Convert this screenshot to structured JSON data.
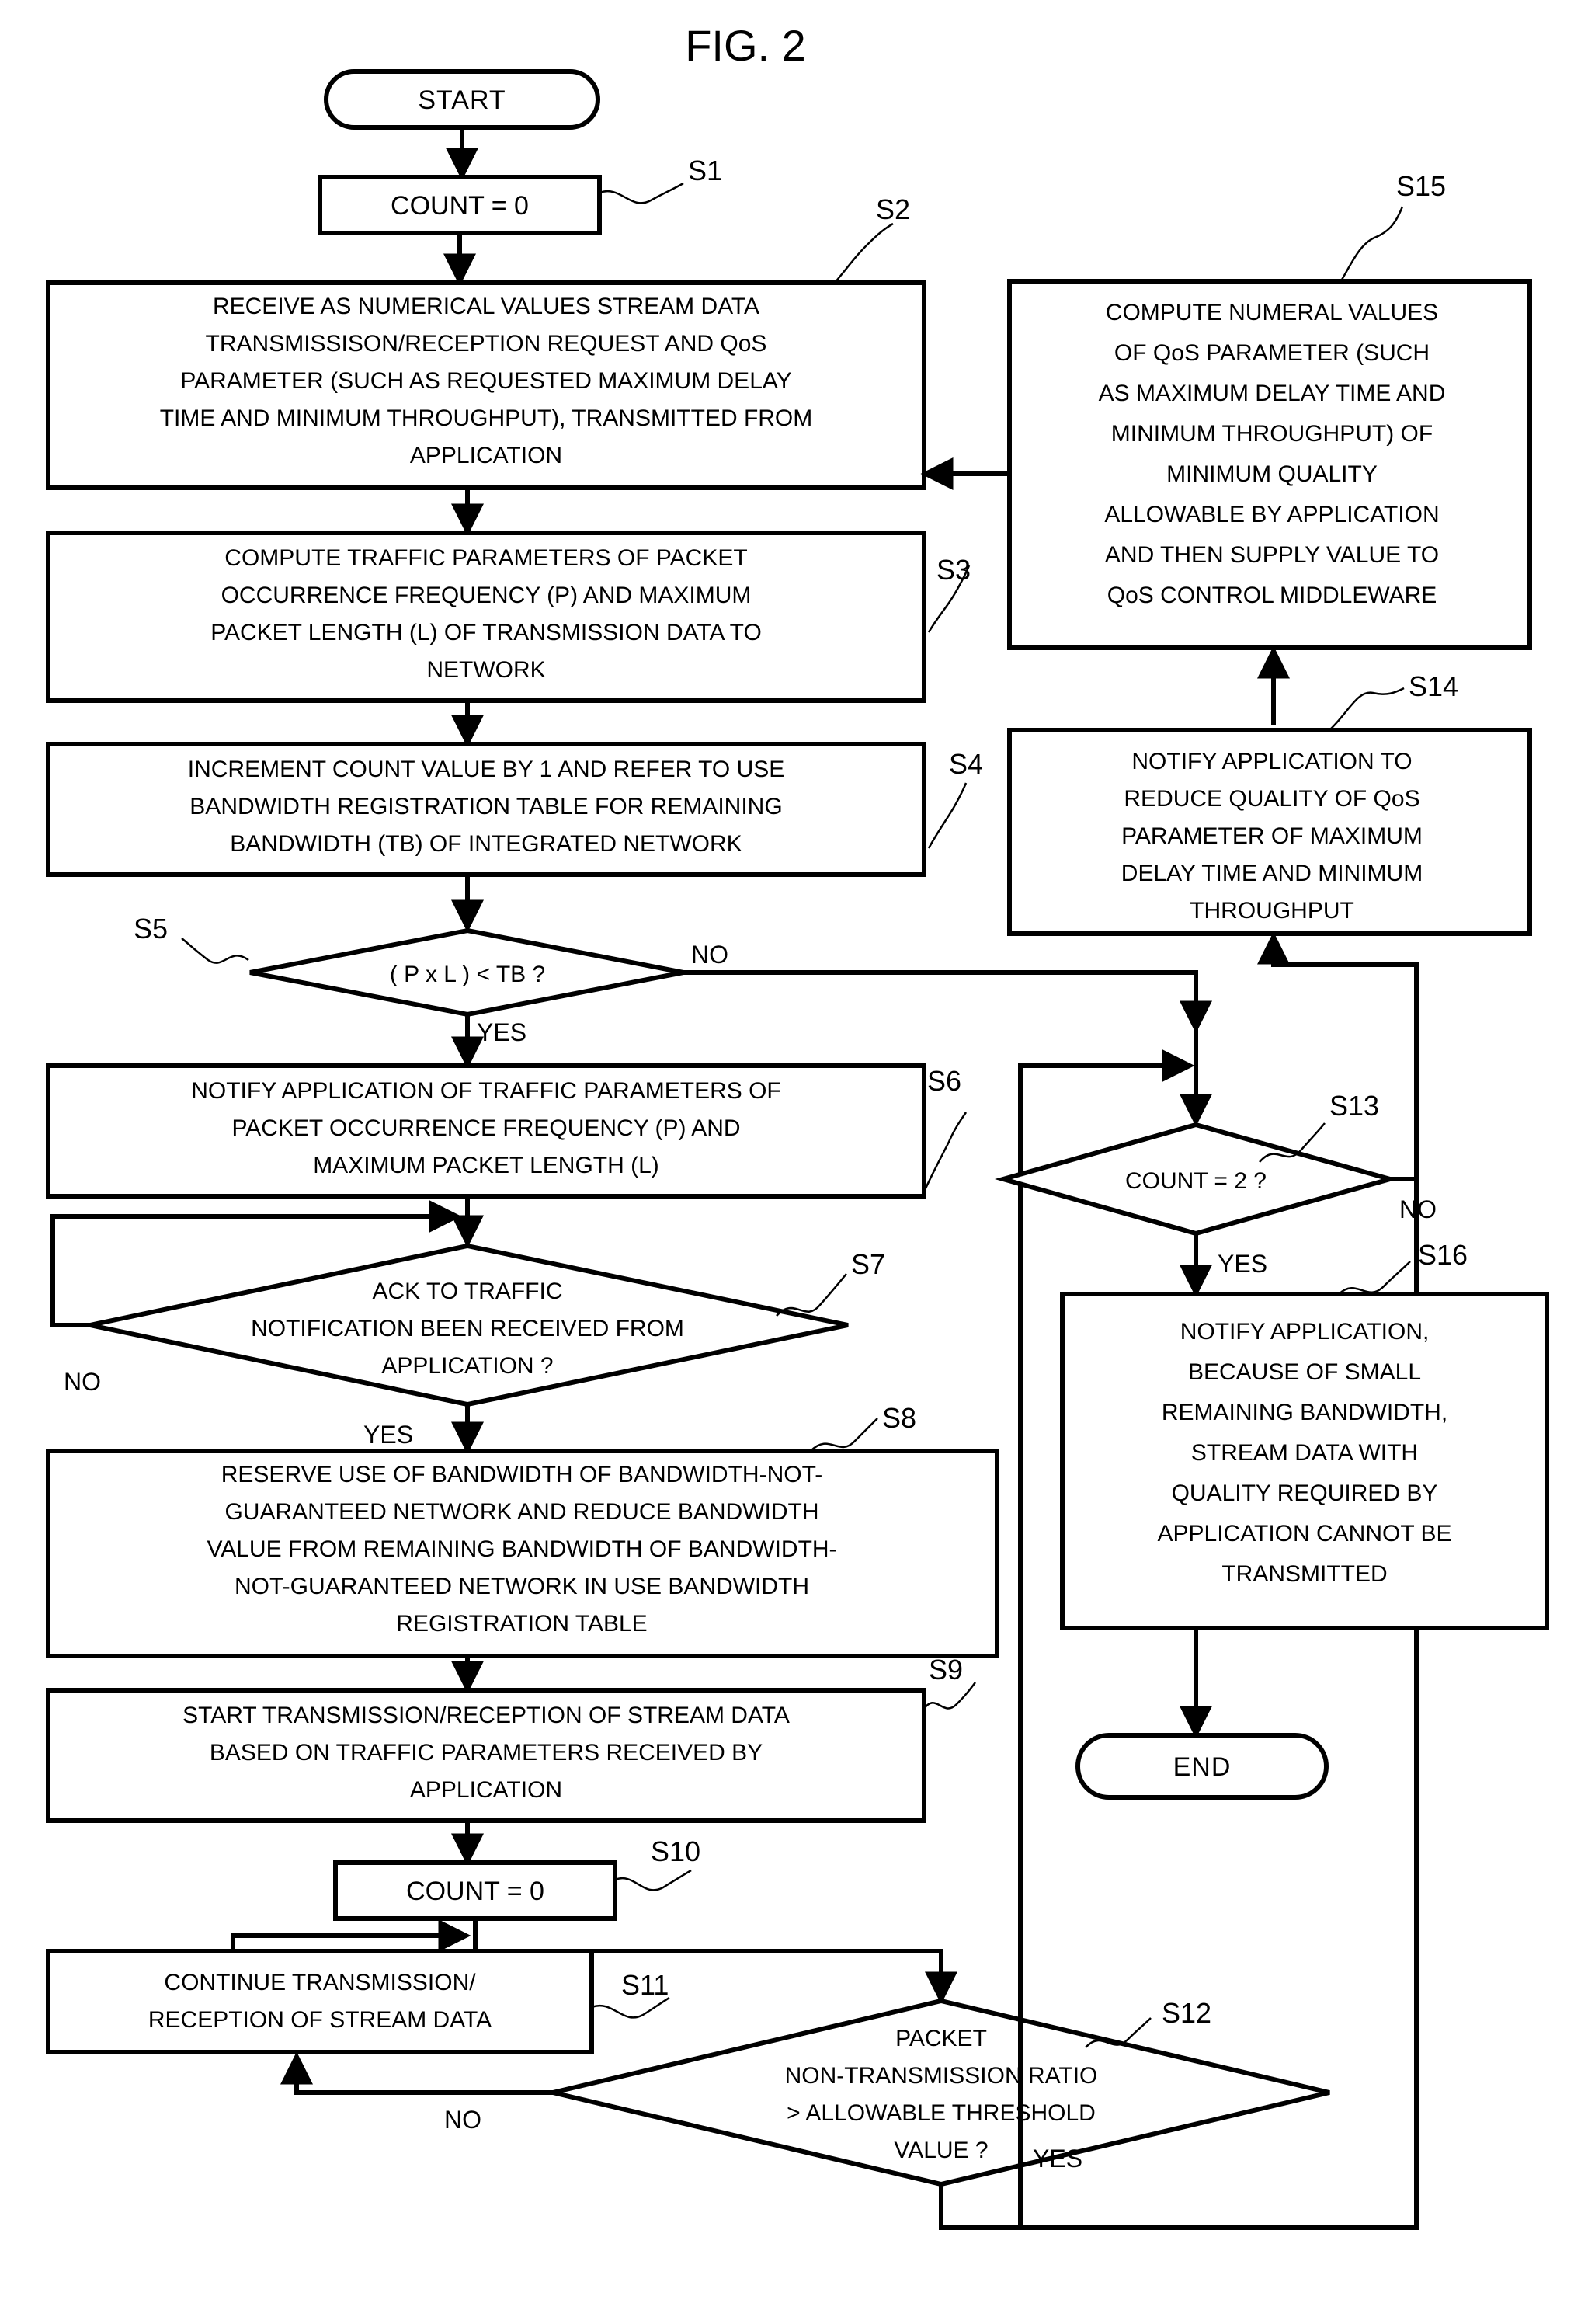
{
  "figure": {
    "title": "FIG. 2"
  },
  "terminals": {
    "start": "START",
    "end": "END"
  },
  "step_labels": {
    "s1": "S1",
    "s2": "S2",
    "s3": "S3",
    "s4": "S4",
    "s5": "S5",
    "s6": "S6",
    "s7": "S7",
    "s8": "S8",
    "s9": "S9",
    "s10": "S10",
    "s11": "S11",
    "s12": "S12",
    "s13": "S13",
    "s14": "S14",
    "s15": "S15",
    "s16": "S16"
  },
  "nodes": {
    "s1": {
      "id": "S1",
      "type": "process",
      "lines": [
        "COUNT = 0"
      ]
    },
    "s2": {
      "id": "S2",
      "type": "process",
      "lines": [
        "RECEIVE AS NUMERICAL VALUES STREAM DATA",
        "TRANSMISSISON/RECEPTION REQUEST AND QoS",
        "PARAMETER (SUCH AS REQUESTED MAXIMUM DELAY",
        "TIME AND MINIMUM THROUGHPUT), TRANSMITTED FROM",
        "APPLICATION"
      ]
    },
    "s3": {
      "id": "S3",
      "type": "process",
      "lines": [
        "COMPUTE TRAFFIC PARAMETERS OF PACKET",
        "OCCURRENCE FREQUENCY (P) AND MAXIMUM",
        "PACKET LENGTH (L)  OF TRANSMISSION DATA TO",
        "NETWORK"
      ]
    },
    "s4": {
      "id": "S4",
      "type": "process",
      "lines": [
        "INCREMENT COUNT VALUE BY 1 AND REFER TO USE",
        "BANDWIDTH REGISTRATION TABLE FOR REMAINING",
        "BANDWIDTH (TB) OF INTEGRATED NETWORK"
      ]
    },
    "s5": {
      "id": "S5",
      "type": "decision",
      "lines": [
        "( P x L ) < TB ?"
      ],
      "yes": "YES",
      "no": "NO"
    },
    "s6": {
      "id": "S6",
      "type": "process",
      "lines": [
        "NOTIFY APPLICATION OF TRAFFIC PARAMETERS OF",
        "PACKET OCCURRENCE FREQUENCY (P) AND",
        "MAXIMUM PACKET LENGTH (L)"
      ]
    },
    "s7": {
      "id": "S7",
      "type": "decision",
      "lines": [
        "ACK TO TRAFFIC",
        "NOTIFICATION BEEN RECEIVED FROM",
        "APPLICATION ?"
      ],
      "yes": "YES",
      "no": "NO"
    },
    "s8": {
      "id": "S8",
      "type": "process",
      "lines": [
        "RESERVE USE OF BANDWIDTH OF BANDWIDTH-NOT-",
        "GUARANTEED NETWORK AND REDUCE  BANDWIDTH",
        "VALUE FROM REMAINING BANDWIDTH OF BANDWIDTH-",
        "NOT-GUARANTEED NETWORK IN USE BANDWIDTH",
        "REGISTRATION TABLE"
      ]
    },
    "s9": {
      "id": "S9",
      "type": "process",
      "lines": [
        "START TRANSMISSION/RECEPTION OF STREAM DATA",
        "BASED ON TRAFFIC PARAMETERS RECEIVED BY",
        "APPLICATION"
      ]
    },
    "s10": {
      "id": "S10",
      "type": "process",
      "lines": [
        "COUNT = 0"
      ]
    },
    "s11": {
      "id": "S11",
      "type": "process",
      "lines": [
        "CONTINUE TRANSMISSION/",
        "RECEPTION OF STREAM DATA"
      ]
    },
    "s12": {
      "id": "S12",
      "type": "decision",
      "lines": [
        "PACKET",
        "NON-TRANSMISSION RATIO",
        "> ALLOWABLE THRESHOLD",
        "VALUE ?"
      ],
      "yes": "YES",
      "no": "NO"
    },
    "s13": {
      "id": "S13",
      "type": "decision",
      "lines": [
        "COUNT = 2 ?"
      ],
      "yes": "YES",
      "no": "NO"
    },
    "s14": {
      "id": "S14",
      "type": "process",
      "lines": [
        "NOTIFY APPLICATION TO",
        "REDUCE QUALITY OF QoS",
        "PARAMETER OF MAXIMUM",
        "DELAY TIME AND MINIMUM",
        "THROUGHPUT"
      ]
    },
    "s15": {
      "id": "S15",
      "type": "process",
      "lines": [
        "COMPUTE NUMERAL VALUES",
        "OF QoS PARAMETER (SUCH",
        "AS MAXIMUM DELAY TIME AND",
        "MINIMUM THROUGHPUT) OF",
        "MINIMUM QUALITY",
        "ALLOWABLE BY APPLICATION",
        "AND THEN SUPPLY VALUE TO",
        "QoS CONTROL MIDDLEWARE"
      ]
    },
    "s16": {
      "id": "S16",
      "type": "process",
      "lines": [
        "NOTIFY APPLICATION,",
        "BECAUSE OF SMALL",
        "REMAINING BANDWIDTH,",
        "STREAM DATA WITH",
        "QUALITY REQUIRED BY",
        "APPLICATION CANNOT BE",
        "TRANSMITTED"
      ]
    }
  },
  "branch_labels": {
    "s5_no": "NO",
    "s5_yes": "YES",
    "s7_no": "NO",
    "s7_yes": "YES",
    "s12_no": "NO",
    "s12_yes": "YES",
    "s13_no": "NO",
    "s13_yes": "YES"
  },
  "colors": {
    "stroke": "#000000",
    "fill": "#ffffff"
  }
}
